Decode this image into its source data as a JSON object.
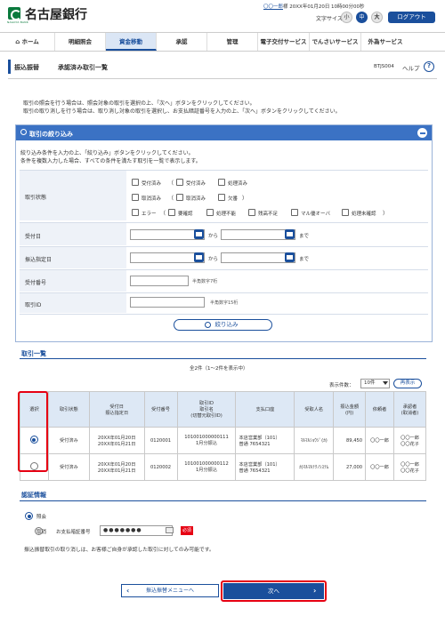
{
  "header": {
    "bank_name": "名古屋銀行",
    "logo_sub": "NAGOYA BANK",
    "user_name": "〇〇一郎",
    "user_suffix": "様",
    "last_login": "20XX年01月20日 10時00分00秒",
    "font_size_label": "文字サイズ",
    "font_small": "小",
    "font_mid": "中",
    "font_large": "大",
    "logout": "ログアウト"
  },
  "nav": [
    "ホーム",
    "明細照会",
    "資金移動",
    "承認",
    "管理",
    "電子交付サービス",
    "でんさいサービス",
    "外為サービス"
  ],
  "page": {
    "title": "振込振替",
    "subtitle": "承認済み取引一覧",
    "screen_id": "BTJS004",
    "help": "ヘルプ",
    "instruction1": "取引の照会を行う場合は、照会対象の取引を選択の上、「次へ」ボタンをクリックしてください。",
    "instruction2": "取引の取り消しを行う場合は、取り消し対象の取引を選択し、お支払暗証番号を入力の上、「次へ」ボタンをクリックしてください。"
  },
  "filter": {
    "title": "取引の絞り込み",
    "desc1": "絞り込み条件を入力の上、「絞り込み」ボタンをクリックしてください。",
    "desc2": "条件を複数入力した場合、すべての条件を満たす取引を一覧で表示します。",
    "status_label": "取引状態",
    "status_options": {
      "accepted": "受付済み",
      "accepted2": "受付済み",
      "processed": "処理済み",
      "cancelled": "取消済み",
      "cancelled2": "取消済み",
      "failed": "欠番",
      "error": "エラー",
      "suspended": "要確認",
      "processing_failed": "処理不能",
      "insufficient": "残高不足",
      "limit_over": "マル優オーバ",
      "pending": "処理未確認"
    },
    "open_paren": "（",
    "close_paren": "）",
    "accept_date_label": "受付日",
    "transfer_date_label": "振込指定日",
    "from": "から",
    "to": "まで",
    "accept_no_label": "受付番号",
    "accept_no_hint": "半角数字7桁",
    "tx_id_label": "取引ID",
    "tx_id_hint": "半角数字15桁",
    "filter_button": "絞り込み"
  },
  "list": {
    "title": "取引一覧",
    "count_text": "全2件（1〜2件を表示中）",
    "per_page_label": "表示件数：",
    "per_page_value": "10件",
    "redisplay": "再表示",
    "headers": {
      "select": "選択",
      "status": "取引状態",
      "date1": "受付日",
      "date2": "振込指定日",
      "accept_no": "受付番号",
      "id1": "取引ID",
      "id2": "取引名",
      "id3": "(切替元取引ID)",
      "account": "支払口座",
      "payee": "受取人名",
      "amount1": "振込金額",
      "amount2": "(円)",
      "requester": "依頼者",
      "approver1": "承認者",
      "approver2": "(取消者)"
    },
    "rows": [
      {
        "selected": true,
        "status": "受付済み",
        "date1": "20XX年01月20日",
        "date2": "20XX年01月21日",
        "accept_no": "0120001",
        "id": "101001000000111",
        "name": "1月分振込",
        "branch": "本店営業部（101）",
        "account": "普通 7654321",
        "payee": "ﾏﾙﾏﾙｼｮｳｼﾞ(ｶ)",
        "amount": "89,450",
        "requester": "〇〇一郎",
        "approver1": "〇〇一郎",
        "approver2": "〇〇花子"
      },
      {
        "selected": false,
        "status": "受付済み",
        "date1": "20XX年01月20日",
        "date2": "20XX年01月21日",
        "accept_no": "0120002",
        "id": "101001000000112",
        "name": "1月分振込",
        "branch": "本店営業部（101）",
        "account": "普通 7654321",
        "payee": "ｶ)ﾏﾙﾏﾙﾃｸﾉｼｽﾃﾑ",
        "amount": "27,000",
        "requester": "〇〇一郎",
        "approver1": "〇〇一郎",
        "approver2": "〇〇花子"
      }
    ]
  },
  "auth": {
    "title": "認証情報",
    "approve_label": "照会",
    "cancel_label": "取消",
    "pin_label": "お支払暗証番号",
    "pin_value": "●●●●●●●",
    "required": "必須",
    "note": "振込振替取引の取り消しは、お客様ご自身が承認した取引に対してのみ可能です。"
  },
  "buttons": {
    "back": "振込振替メニューへ",
    "next": "次へ"
  },
  "colors": {
    "brand": "#1a4f9c",
    "panel_header": "#3b72c4",
    "highlight": "#e60012",
    "logo": "#0a7a3d"
  }
}
